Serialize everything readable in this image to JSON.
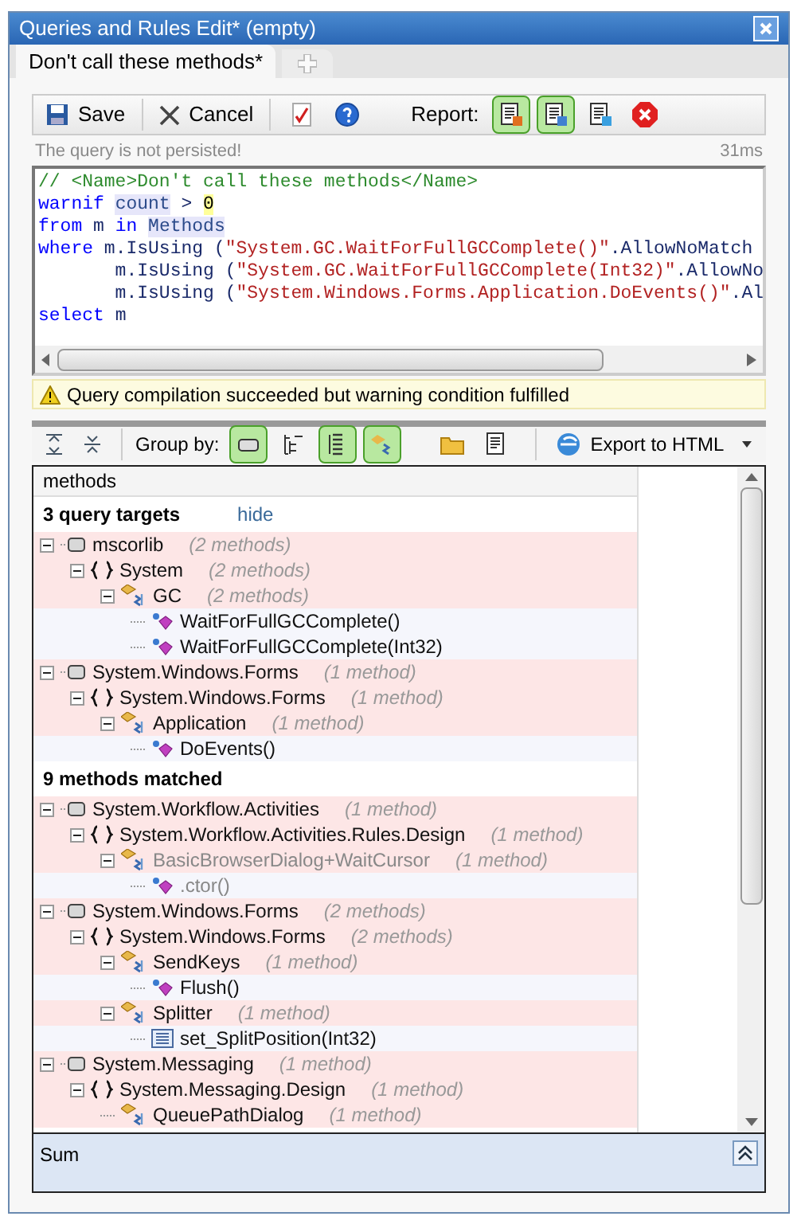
{
  "window": {
    "title": "Queries and Rules Edit* (empty)"
  },
  "tabs": [
    {
      "label": "Don't call these methods*",
      "selected": true
    }
  ],
  "toolbar": {
    "save": "Save",
    "cancel": "Cancel",
    "report_label": "Report:",
    "report_buttons": [
      {
        "selected": true
      },
      {
        "selected": true
      },
      {
        "selected": false
      }
    ]
  },
  "status": {
    "message": "The query is not persisted!",
    "time": "31ms"
  },
  "code_lines": [
    [
      {
        "kind": "comment",
        "text": "// <Name>Don't call these methods</Name>"
      }
    ],
    [
      {
        "kind": "keyword",
        "text": "warnif "
      },
      {
        "kind": "ident",
        "text": "count"
      },
      {
        "kind": "plain",
        "text": " > "
      },
      {
        "kind": "number",
        "text": "0"
      }
    ],
    [
      {
        "kind": "keyword",
        "text": "from"
      },
      {
        "kind": "plain",
        "text": " m "
      },
      {
        "kind": "keyword",
        "text": "in "
      },
      {
        "kind": "ident",
        "text": "Methods"
      }
    ],
    [
      {
        "kind": "keyword",
        "text": "where"
      },
      {
        "kind": "plain",
        "text": " m.IsUsing ("
      },
      {
        "kind": "string",
        "text": "\"System.GC.WaitForFullGCComplete()\""
      },
      {
        "kind": "plain",
        "text": ".AllowNoMatch"
      }
    ],
    [
      {
        "kind": "plain",
        "text": "       m.IsUsing ("
      },
      {
        "kind": "string",
        "text": "\"System.GC.WaitForFullGCComplete(Int32)\""
      },
      {
        "kind": "plain",
        "text": ".AllowNo"
      }
    ],
    [
      {
        "kind": "plain",
        "text": "       m.IsUsing ("
      },
      {
        "kind": "string",
        "text": "\"System.Windows.Forms.Application.DoEvents()\""
      },
      {
        "kind": "plain",
        "text": ".Al"
      }
    ],
    [
      {
        "kind": "keyword",
        "text": "select"
      },
      {
        "kind": "plain",
        "text": " m"
      }
    ]
  ],
  "warning": "Query compilation succeeded but warning condition fulfilled",
  "results_toolbar": {
    "group_by_label": "Group by:",
    "group_buttons": [
      {
        "selected": true
      },
      {
        "selected": false
      },
      {
        "selected": true
      },
      {
        "selected": true
      },
      {
        "selected": false
      },
      {
        "selected": false
      }
    ],
    "export": "Export to HTML"
  },
  "results": {
    "column": "methods",
    "sections": [
      {
        "title": "3 query targets",
        "link": "hide",
        "nodes": [
          {
            "kind": "assembly",
            "name": "mscorlib",
            "count": "(2 methods)",
            "dimmed": false,
            "children": [
              {
                "kind": "namespace",
                "name": "System",
                "count": "(2 methods)",
                "dimmed": false,
                "children": [
                  {
                    "kind": "type",
                    "name": "GC",
                    "count": "(2 methods)",
                    "dimmed": false,
                    "children": [
                      {
                        "kind": "method",
                        "name": "WaitForFullGCComplete()",
                        "dimmed": false
                      },
                      {
                        "kind": "method",
                        "name": "WaitForFullGCComplete(Int32)",
                        "dimmed": false
                      }
                    ]
                  }
                ]
              }
            ]
          },
          {
            "kind": "assembly",
            "name": "System.Windows.Forms",
            "count": "(1 method)",
            "dimmed": false,
            "children": [
              {
                "kind": "namespace",
                "name": "System.Windows.Forms",
                "count": "(1 method)",
                "dimmed": false,
                "children": [
                  {
                    "kind": "type",
                    "name": "Application",
                    "count": "(1 method)",
                    "dimmed": false,
                    "children": [
                      {
                        "kind": "method",
                        "name": "DoEvents()",
                        "dimmed": false
                      }
                    ]
                  }
                ]
              }
            ]
          }
        ]
      },
      {
        "title": "9 methods matched",
        "nodes": [
          {
            "kind": "assembly",
            "name": "System.Workflow.Activities",
            "count": "(1 method)",
            "dimmed": false,
            "children": [
              {
                "kind": "namespace",
                "name": "System.Workflow.Activities.Rules.Design",
                "count": "(1 method)",
                "dimmed": false,
                "children": [
                  {
                    "kind": "type",
                    "name": "BasicBrowserDialog+WaitCursor",
                    "count": "(1 method)",
                    "dimmed": true,
                    "children": [
                      {
                        "kind": "method",
                        "name": ".ctor()",
                        "dimmed": true
                      }
                    ]
                  }
                ]
              }
            ]
          },
          {
            "kind": "assembly",
            "name": "System.Windows.Forms",
            "count": "(2 methods)",
            "dimmed": false,
            "children": [
              {
                "kind": "namespace",
                "name": "System.Windows.Forms",
                "count": "(2 methods)",
                "dimmed": false,
                "children": [
                  {
                    "kind": "type",
                    "name": "SendKeys",
                    "count": "(1 method)",
                    "dimmed": false,
                    "children": [
                      {
                        "kind": "method",
                        "name": "Flush()",
                        "dimmed": false
                      }
                    ]
                  },
                  {
                    "kind": "type",
                    "name": "Splitter",
                    "count": "(1 method)",
                    "dimmed": false,
                    "children": [
                      {
                        "kind": "setter",
                        "name": "set_SplitPosition(Int32)",
                        "dimmed": false
                      }
                    ]
                  }
                ]
              }
            ]
          },
          {
            "kind": "assembly",
            "name": "System.Messaging",
            "count": "(1 method)",
            "dimmed": false,
            "children": [
              {
                "kind": "namespace",
                "name": "System.Messaging.Design",
                "count": "(1 method)",
                "dimmed": false,
                "children": [
                  {
                    "kind": "type",
                    "name": "QueuePathDialog",
                    "count": "(1 method)",
                    "dimmed": false
                  }
                ]
              }
            ]
          }
        ]
      }
    ]
  },
  "footer": {
    "label": "Sum"
  }
}
